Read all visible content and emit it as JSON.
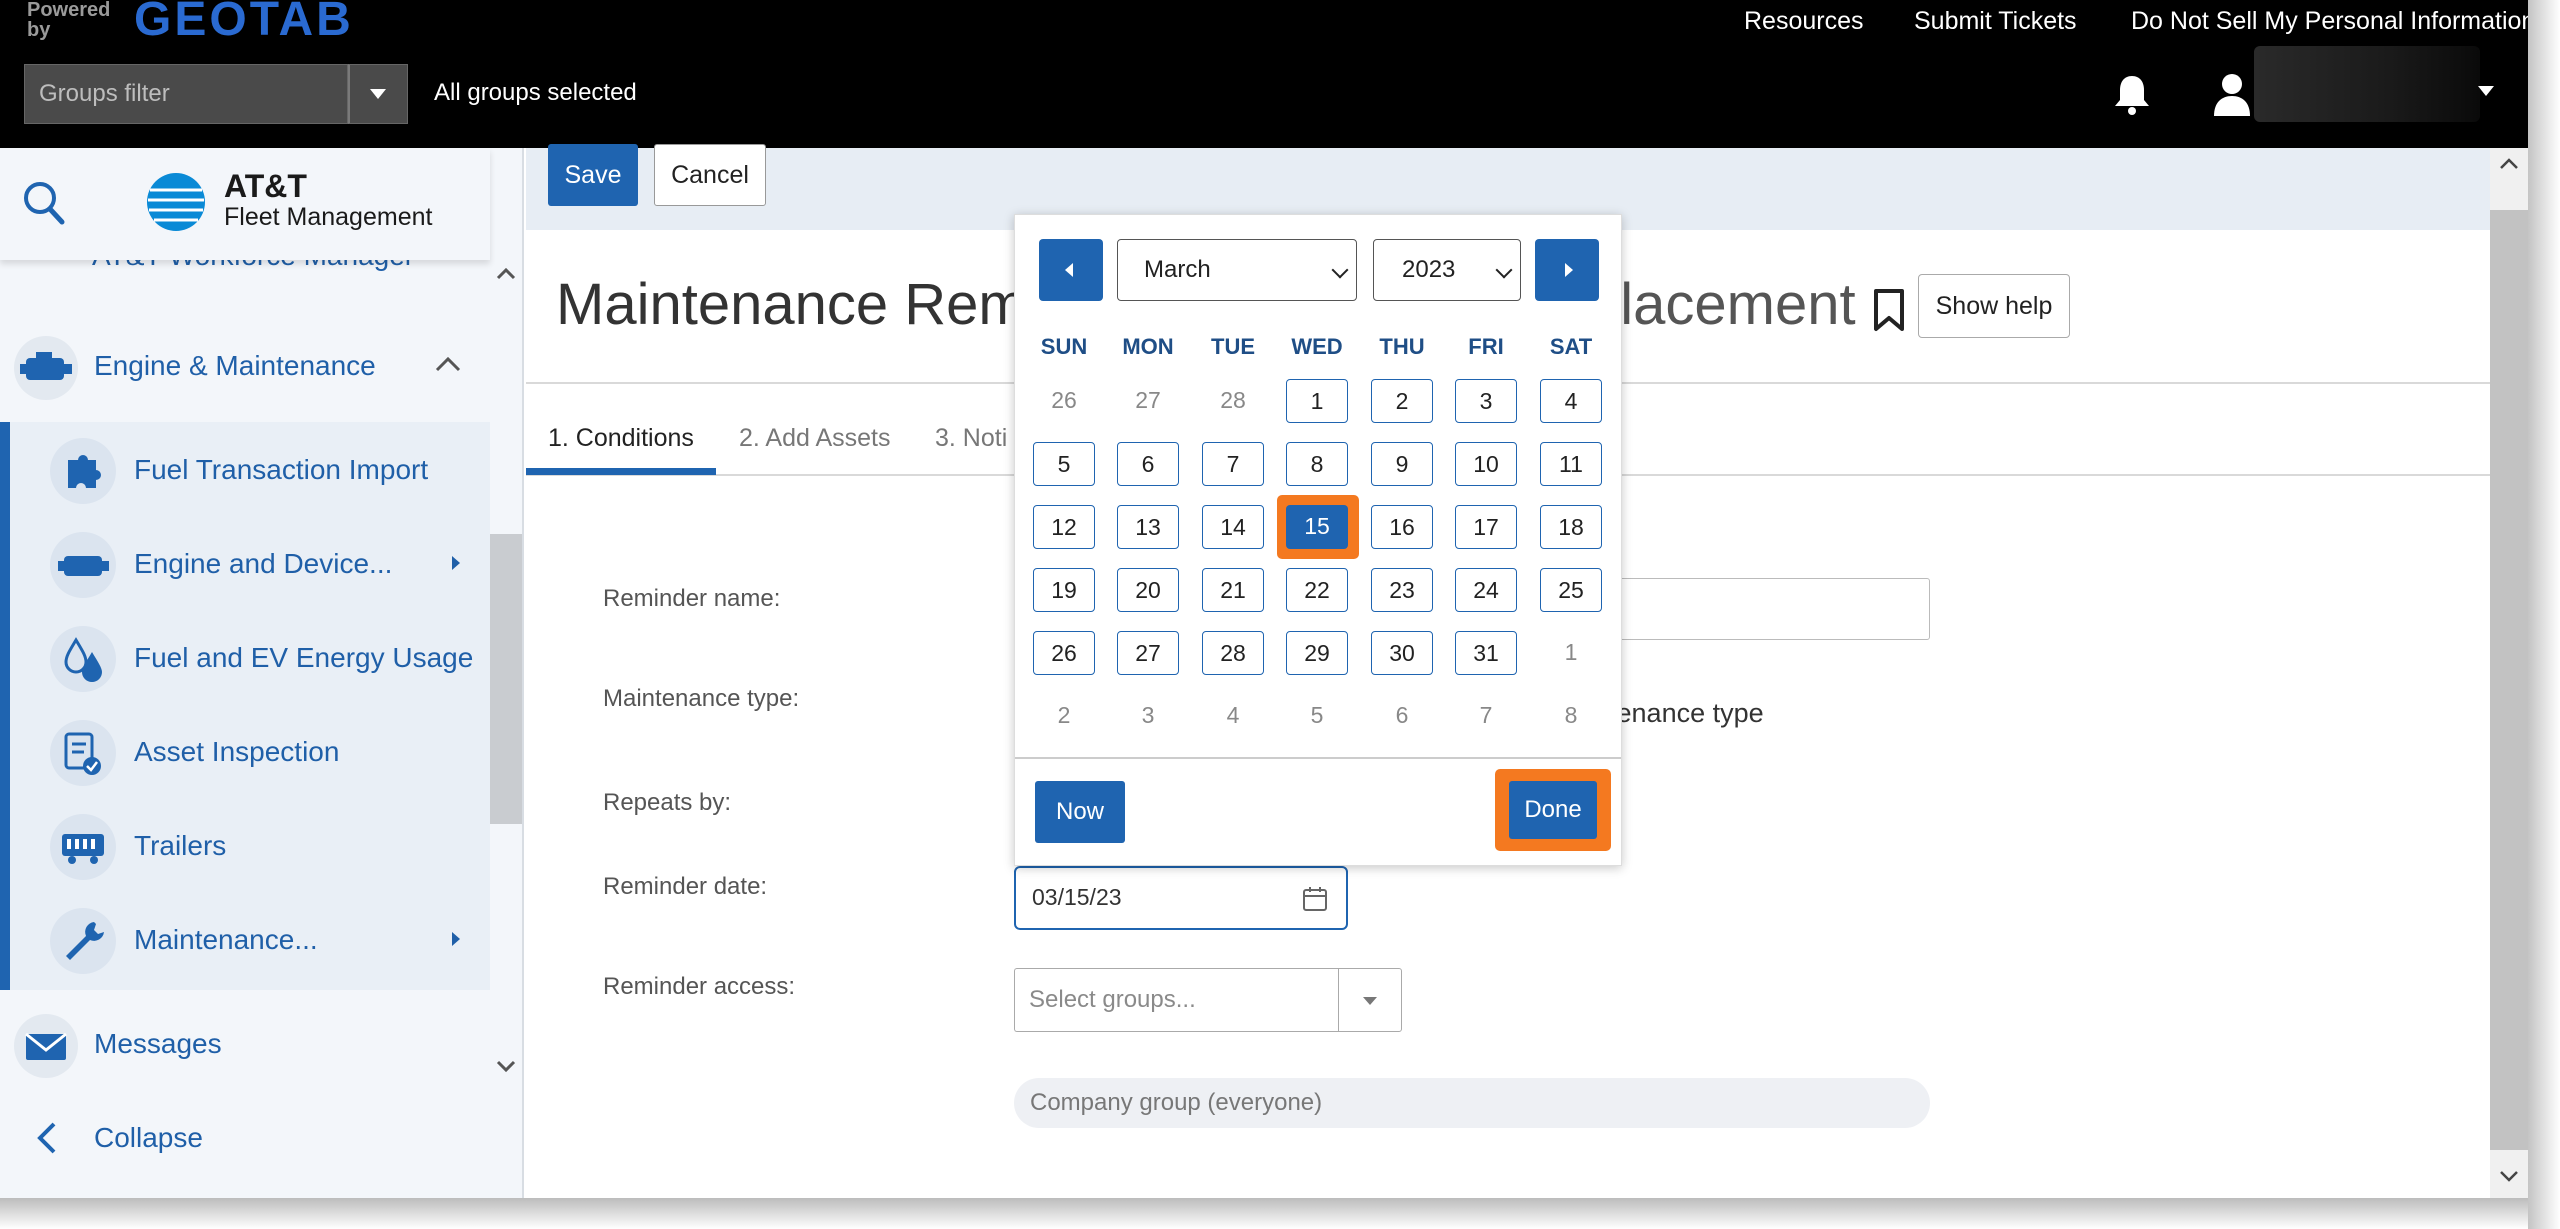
{
  "header": {
    "powered_by": "Powered by",
    "brand": "GEOTAB",
    "links": [
      "Resources",
      "Submit Tickets",
      "Do Not Sell My Personal Information"
    ],
    "groups_filter_placeholder": "Groups filter",
    "groups_status": "All groups selected"
  },
  "sidebar": {
    "logo_title": "AT&T",
    "logo_subtitle": "Fleet Management",
    "partial_item": "AT&T Workforce Manager",
    "top_items": [
      {
        "label": "Engine & Maintenance"
      },
      {
        "label": "Messages"
      },
      {
        "label": "Collapse"
      }
    ],
    "sub_items": [
      {
        "label": "Fuel Transaction Import"
      },
      {
        "label": "Engine and Device..."
      },
      {
        "label": "Fuel and EV Energy Usage"
      },
      {
        "label": "Asset Inspection"
      },
      {
        "label": "Trailers"
      },
      {
        "label": "Maintenance..."
      }
    ]
  },
  "toolbar": {
    "save_label": "Save",
    "cancel_label": "Cancel"
  },
  "page": {
    "title_left": "Maintenance Remin",
    "title_right": "placement",
    "show_help": "Show help",
    "tabs": [
      "1. Conditions",
      "2. Add Assets",
      "3. Noti"
    ]
  },
  "form": {
    "reminder_name_label": "Reminder name:",
    "maintenance_type_label": "Maintenance type:",
    "maintenance_type_partial": "ntenance type",
    "repeats_by_label": "Repeats by:",
    "reminder_date_label": "Reminder date:",
    "reminder_date_value": "03/15/23",
    "reminder_access_label": "Reminder access:",
    "groups_placeholder": "Select groups...",
    "company_group": "Company group (everyone)"
  },
  "calendar": {
    "month": "March",
    "year": "2023",
    "weekdays": [
      "SUN",
      "MON",
      "TUE",
      "WED",
      "THU",
      "FRI",
      "SAT"
    ],
    "weeks": [
      [
        "26",
        "27",
        "28",
        "1",
        "2",
        "3",
        "4"
      ],
      [
        "5",
        "6",
        "7",
        "8",
        "9",
        "10",
        "11"
      ],
      [
        "12",
        "13",
        "14",
        "15",
        "16",
        "17",
        "18"
      ],
      [
        "19",
        "20",
        "21",
        "22",
        "23",
        "24",
        "25"
      ],
      [
        "26",
        "27",
        "28",
        "29",
        "30",
        "31",
        "1"
      ],
      [
        "2",
        "3",
        "4",
        "5",
        "6",
        "7",
        "8"
      ]
    ],
    "selected_day": "15",
    "now_label": "Now",
    "done_label": "Done"
  },
  "colors": {
    "accent": "#1f64b0",
    "highlight": "#f47920",
    "topbar": "#000000"
  }
}
